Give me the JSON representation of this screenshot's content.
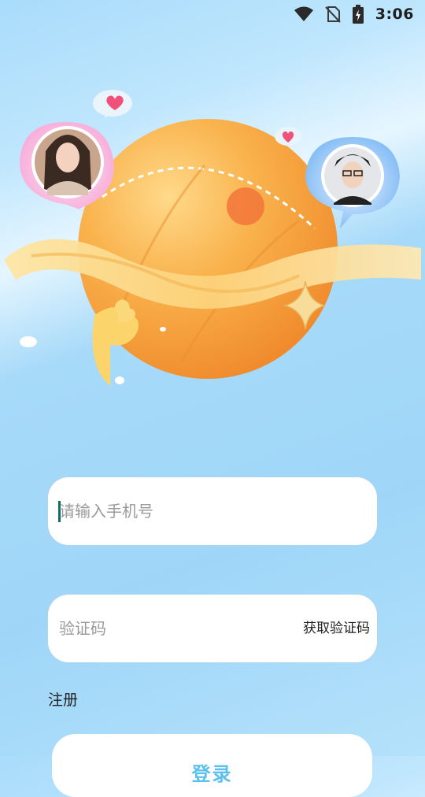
{
  "status_bar": {
    "time": "3:06",
    "icons": [
      "wifi-icon",
      "no-sim-icon",
      "battery-charging-icon"
    ]
  },
  "hero": {
    "description_icons": [
      "planet-illustration",
      "female-avatar",
      "male-avatar",
      "heart-bubble-icon",
      "star-icon"
    ]
  },
  "login_form": {
    "phone_placeholder": "请输入手机号",
    "phone_value": "",
    "code_placeholder": "验证码",
    "code_value": "",
    "get_code_label": "获取验证码",
    "register_label": "注册",
    "login_label": "登录"
  },
  "colors": {
    "accent": "#5cc0ef",
    "caret": "#0d6e5e",
    "planet": "#f7a640"
  }
}
